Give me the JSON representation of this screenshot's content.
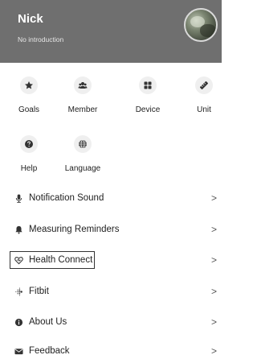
{
  "profile": {
    "name": "Nick",
    "intro": "No introduction"
  },
  "grid": [
    {
      "label": "Goals",
      "icon": "star-icon"
    },
    {
      "label": "Member",
      "icon": "members-icon"
    },
    {
      "label": "Device",
      "icon": "device-grid-icon"
    },
    {
      "label": "Unit",
      "icon": "ruler-icon"
    },
    {
      "label": "Help",
      "icon": "question-icon"
    },
    {
      "label": "Language",
      "icon": "globe-icon"
    }
  ],
  "list": [
    {
      "label": "Notification Sound",
      "icon": "microphone-icon"
    },
    {
      "label": "Measuring Reminders",
      "icon": "bell-icon"
    },
    {
      "label": "Health Connect",
      "icon": "health-connect-icon"
    },
    {
      "label": "Fitbit",
      "icon": "fitbit-icon"
    },
    {
      "label": "About Us",
      "icon": "info-icon"
    },
    {
      "label": "Feedback",
      "icon": "mail-icon"
    }
  ],
  "chevron": ">",
  "colors": {
    "header_bg": "#6f6f6f",
    "icon_circle_bg": "#efefef",
    "icon_color": "#333333"
  }
}
